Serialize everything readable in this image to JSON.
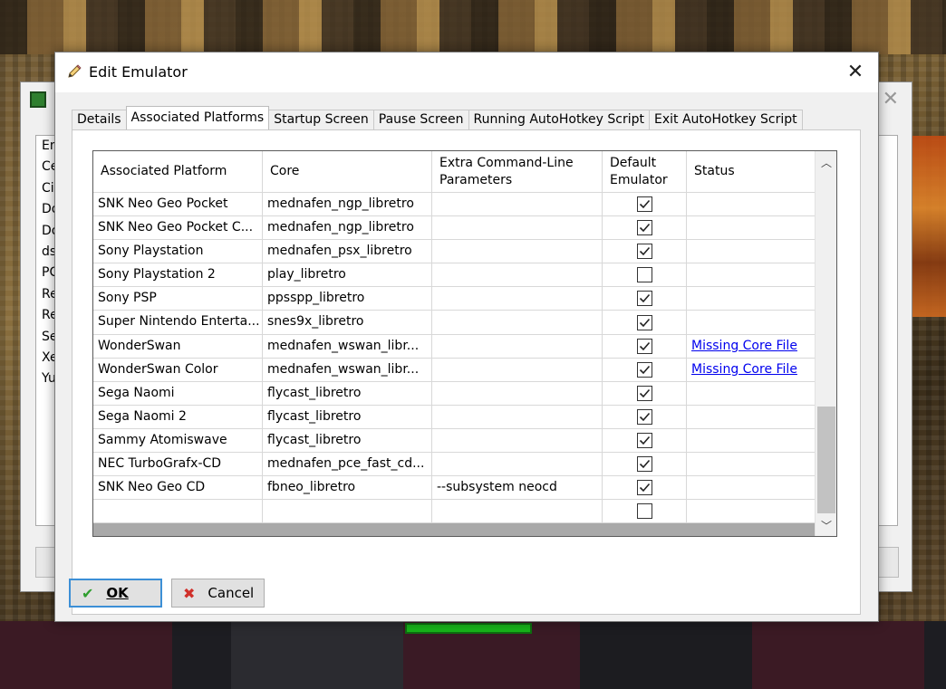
{
  "background_window": {
    "list_items": [
      "En",
      "Ce",
      "Ci",
      "Do",
      "Do",
      "ds",
      "PC",
      "Re",
      "Re",
      "Se",
      "Xe",
      "Yu"
    ]
  },
  "dialog": {
    "title": "Edit Emulator",
    "close_glyph": "✕",
    "tabs": [
      {
        "label": "Details",
        "active": false
      },
      {
        "label": "Associated Platforms",
        "active": true
      },
      {
        "label": "Startup Screen",
        "active": false
      },
      {
        "label": "Pause Screen",
        "active": false
      },
      {
        "label": "Running AutoHotkey Script",
        "active": false
      },
      {
        "label": "Exit AutoHotkey Script",
        "active": false
      }
    ],
    "grid": {
      "headers": {
        "platform": "Associated Platform",
        "core": "Core",
        "params_line1": "Extra Command-Line",
        "params_line2": "Parameters",
        "default_line1": "Default",
        "default_line2": "Emulator",
        "status": "Status"
      },
      "rows": [
        {
          "platform": "SNK Neo Geo Pocket",
          "core": "mednafen_ngp_libretro",
          "params": "",
          "default": true,
          "status": ""
        },
        {
          "platform": "SNK Neo Geo Pocket C...",
          "core": "mednafen_ngp_libretro",
          "params": "",
          "default": true,
          "status": ""
        },
        {
          "platform": "Sony Playstation",
          "core": "mednafen_psx_libretro",
          "params": "",
          "default": true,
          "status": ""
        },
        {
          "platform": "Sony Playstation 2",
          "core": "play_libretro",
          "params": "",
          "default": false,
          "status": ""
        },
        {
          "platform": "Sony PSP",
          "core": "ppsspp_libretro",
          "params": "",
          "default": true,
          "status": ""
        },
        {
          "platform": "Super Nintendo Enterta...",
          "core": "snes9x_libretro",
          "params": "",
          "default": true,
          "status": ""
        },
        {
          "platform": "WonderSwan",
          "core": "mednafen_wswan_libr...",
          "params": "",
          "default": true,
          "status": "Missing Core File"
        },
        {
          "platform": "WonderSwan Color",
          "core": "mednafen_wswan_libr...",
          "params": "",
          "default": true,
          "status": "Missing Core File"
        },
        {
          "platform": "Sega Naomi",
          "core": "flycast_libretro",
          "params": "",
          "default": true,
          "status": ""
        },
        {
          "platform": "Sega Naomi 2",
          "core": "flycast_libretro",
          "params": "",
          "default": true,
          "status": ""
        },
        {
          "platform": "Sammy Atomiswave",
          "core": "flycast_libretro",
          "params": "",
          "default": true,
          "status": ""
        },
        {
          "platform": "NEC TurboGrafx-CD",
          "core": "mednafen_pce_fast_cd...",
          "params": "",
          "default": true,
          "status": ""
        },
        {
          "platform": "SNK Neo Geo CD",
          "core": "fbneo_libretro",
          "params": "--subsystem neocd",
          "default": true,
          "status": ""
        },
        {
          "platform": "",
          "core": "",
          "params": "",
          "default": false,
          "status": ""
        }
      ]
    },
    "buttons": {
      "ok_label": "OK",
      "cancel_label": "Cancel"
    },
    "colors": {
      "link": "#0000ee",
      "ok_border": "#3c8fd6",
      "ok_check": "#2e9e2e",
      "cancel_x": "#d0302a"
    },
    "icons": {
      "title": "pencil-icon",
      "ok": "check-icon",
      "cancel": "x-icon"
    }
  }
}
